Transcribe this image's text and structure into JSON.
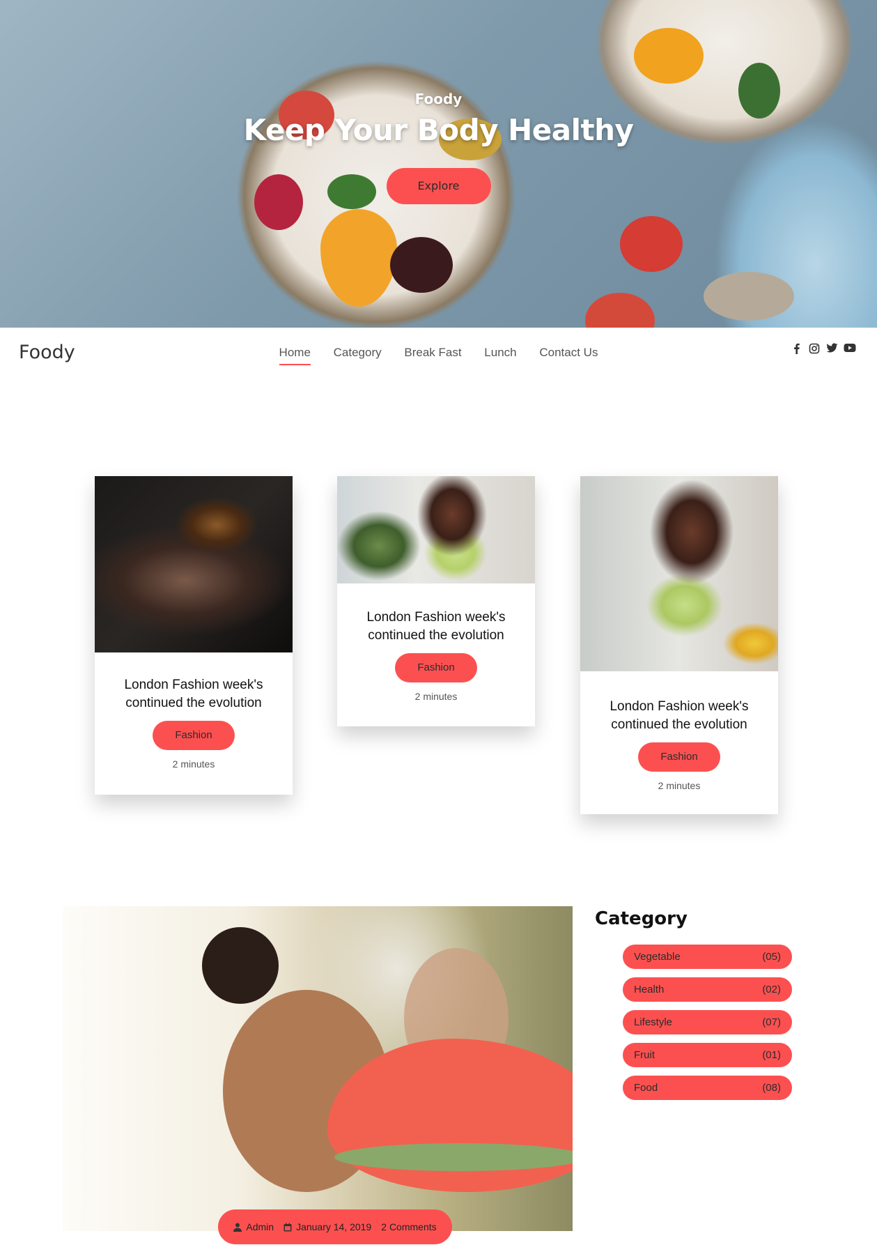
{
  "hero": {
    "small_title": "Foody",
    "title": "Keep Your Body Healthy",
    "cta_label": "Explore"
  },
  "nav": {
    "brand": "Foody",
    "links": [
      {
        "label": "Home",
        "active": true
      },
      {
        "label": "Category",
        "active": false
      },
      {
        "label": "Break Fast",
        "active": false
      },
      {
        "label": "Lunch",
        "active": false
      },
      {
        "label": "Contact Us",
        "active": false
      }
    ],
    "social_icons": [
      "facebook-icon",
      "instagram-icon",
      "twitter-icon",
      "youtube-icon"
    ]
  },
  "cards": [
    {
      "title": "London Fashion week's continued the evolution",
      "tag": "Fashion",
      "read_time": "2 minutes"
    },
    {
      "title": "London Fashion week's continued the evolution",
      "tag": "Fashion",
      "read_time": "2 minutes"
    },
    {
      "title": "London Fashion week's continued the evolution",
      "tag": "Fashion",
      "read_time": "2 minutes"
    }
  ],
  "feature": {
    "author": "Admin",
    "date": "January 14, 2019",
    "comments": "2 Comments"
  },
  "category": {
    "title": "Category",
    "items": [
      {
        "label": "Vegetable",
        "count": "(05)"
      },
      {
        "label": "Health",
        "count": "(02)"
      },
      {
        "label": "Lifestyle",
        "count": "(07)"
      },
      {
        "label": "Fruit",
        "count": "(01)"
      },
      {
        "label": "Food",
        "count": "(08)"
      }
    ]
  },
  "colors": {
    "accent": "#fc5050",
    "text": "#222222",
    "nav_text": "#555555"
  }
}
